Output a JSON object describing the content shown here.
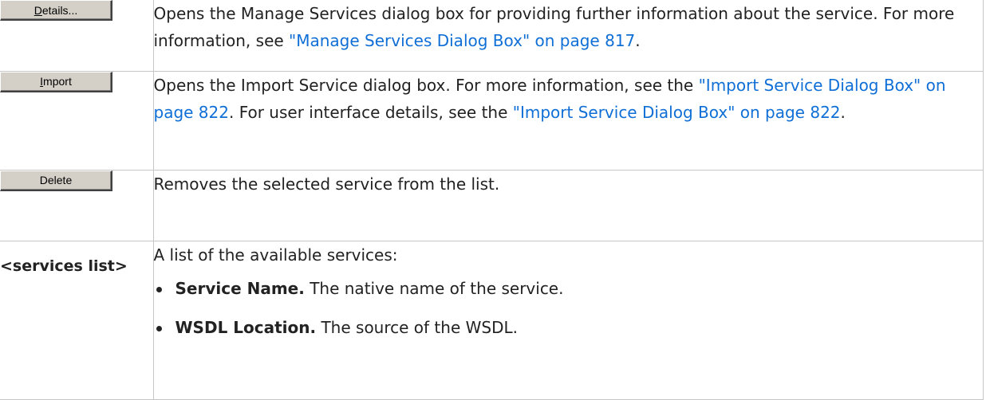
{
  "rows": [
    {
      "button": {
        "before": "",
        "mnemonic": "D",
        "after": "etails..."
      },
      "desc_before": "Opens the Manage Services dialog box for providing further information about the service. For more information, see ",
      "link": "\"Manage Services Dialog Box\" on page 817",
      "desc_after": "."
    },
    {
      "button": {
        "before": "",
        "mnemonic": "I",
        "after": "mport"
      },
      "desc_before": "Opens the Import Service dialog box. For more information, see the ",
      "link1": "\"Import Service Dialog Box\" on page 822",
      "desc_mid": ". For user interface details, see the ",
      "link2": "\"Import Service Dialog Box\" on page 822",
      "desc_after": "."
    },
    {
      "button": {
        "label": "Delete"
      },
      "desc": "Removes the selected service from the list."
    },
    {
      "label": "<services list>",
      "intro": "A list of the available services:",
      "bullets": [
        {
          "term": "Service Name.",
          "text": " The native name of the service."
        },
        {
          "term": "WSDL Location.",
          "text": " The source of the WSDL."
        }
      ]
    }
  ],
  "colors": {
    "link": "#0f6fd6",
    "border": "#c6c6c6",
    "button_face": "#d4d0c8"
  }
}
